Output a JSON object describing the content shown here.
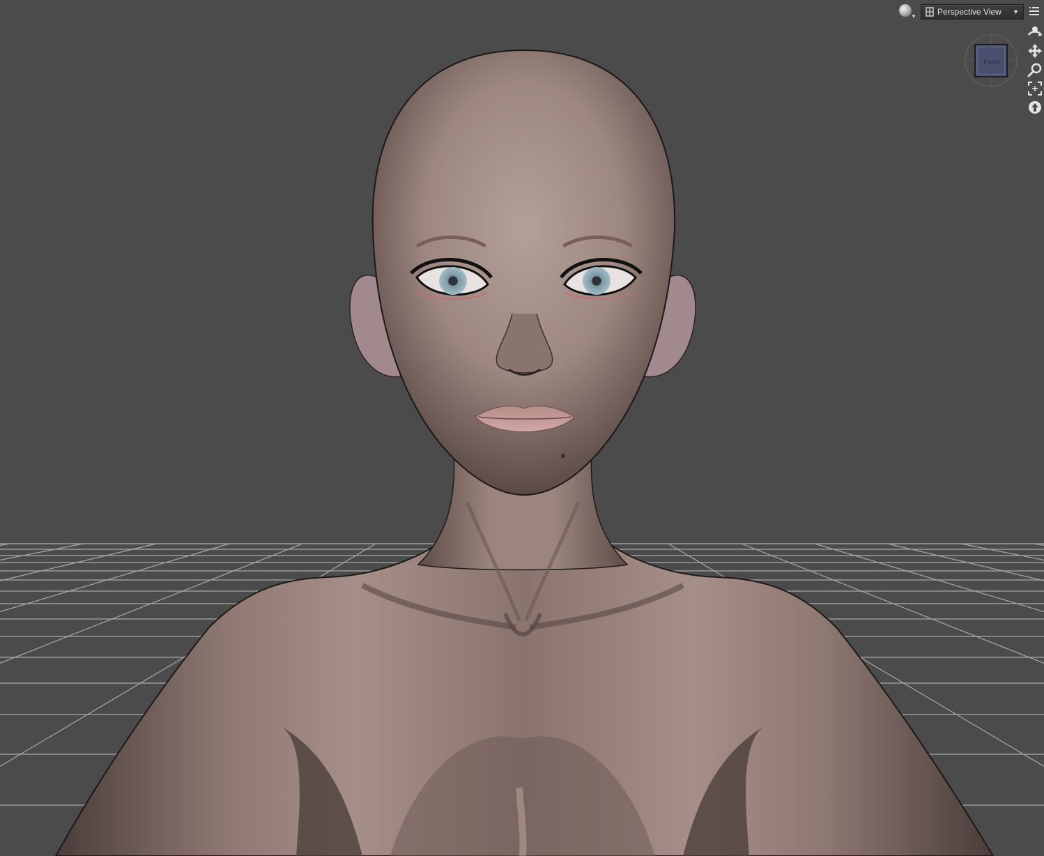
{
  "viewport": {
    "view_label": "Perspective View",
    "background_color": "#4b4b4b",
    "grid_color": "#a9a9a9",
    "draw_style_icon": "sphere-shading-icon",
    "camera_icon": "camera-frame-icon",
    "menu_icon": "viewport-menu-icon"
  },
  "view_cube": {
    "face_label": "Front",
    "face_color": "#4a4f6e"
  },
  "nav_tools": [
    {
      "name": "orbit-icon"
    },
    {
      "name": "pan-icon"
    },
    {
      "name": "zoom-icon"
    },
    {
      "name": "frame-icon"
    },
    {
      "name": "reset-view-icon"
    }
  ],
  "scene": {
    "figure": "female-3d-figure",
    "skin_color": "#9c8680",
    "eye_color": "#8fa9b4"
  }
}
